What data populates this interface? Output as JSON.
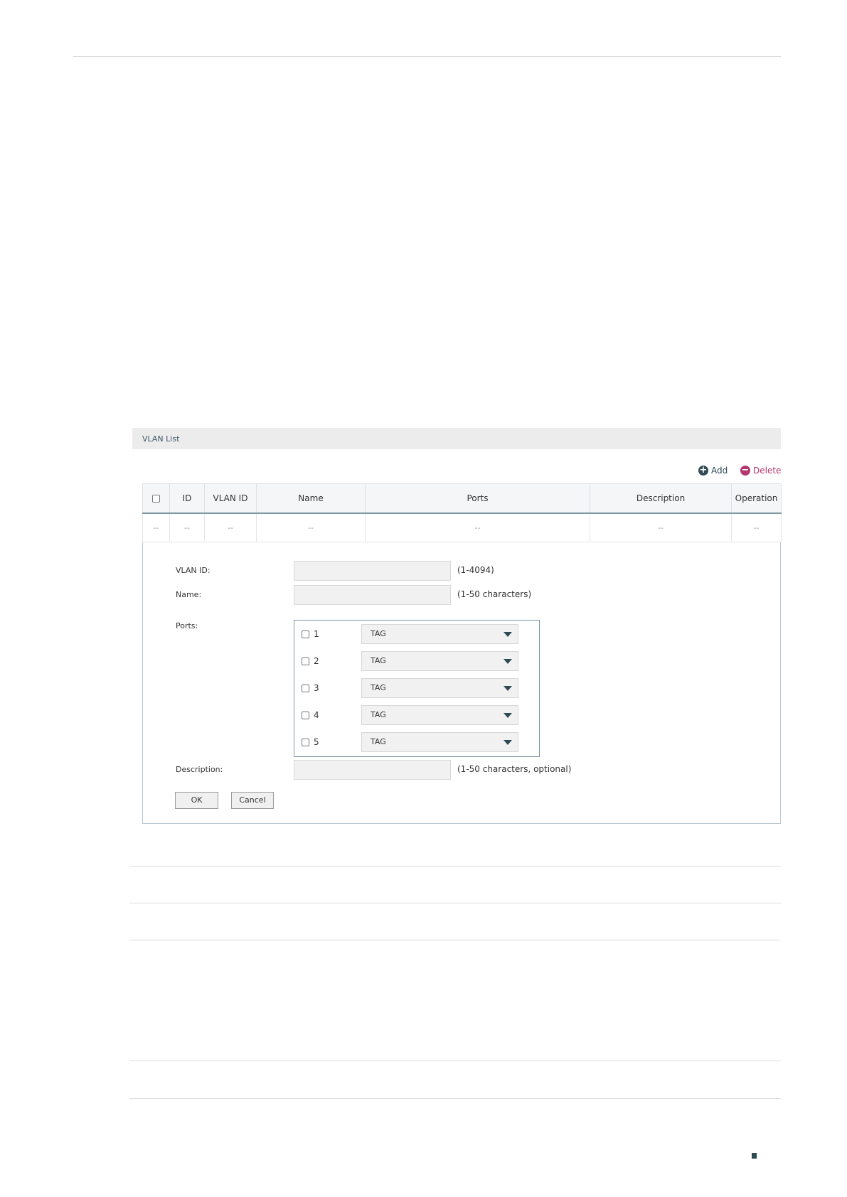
{
  "panel": {
    "title": "VLAN List"
  },
  "toolbar": {
    "add_label": "Add",
    "delete_label": "Delete"
  },
  "table": {
    "columns": [
      "ID",
      "VLAN ID",
      "Name",
      "Ports",
      "Description",
      "Operation"
    ],
    "placeholder_row": [
      "--",
      "--",
      "--",
      "--",
      "--",
      "--",
      "--"
    ]
  },
  "form": {
    "vlan_id_label": "VLAN ID:",
    "vlan_id_value": "",
    "vlan_id_hint": "(1-4094)",
    "name_label": "Name:",
    "name_value": "",
    "name_hint": "(1-50 characters)",
    "ports_label": "Ports:",
    "ports": [
      {
        "number": "1",
        "mode": "TAG"
      },
      {
        "number": "2",
        "mode": "TAG"
      },
      {
        "number": "3",
        "mode": "TAG"
      },
      {
        "number": "4",
        "mode": "TAG"
      },
      {
        "number": "5",
        "mode": "TAG"
      }
    ],
    "description_label": "Description:",
    "description_value": "",
    "description_hint": "(1-50 characters, optional)",
    "ok_label": "OK",
    "cancel_label": "Cancel"
  },
  "colors": {
    "accent": "#2e4a55",
    "delete": "#b3366e",
    "header_bg": "#ececec"
  },
  "icons": {
    "add": "plus-circle-icon",
    "delete": "minus-circle-icon",
    "dropdown": "triangle-down-icon"
  }
}
